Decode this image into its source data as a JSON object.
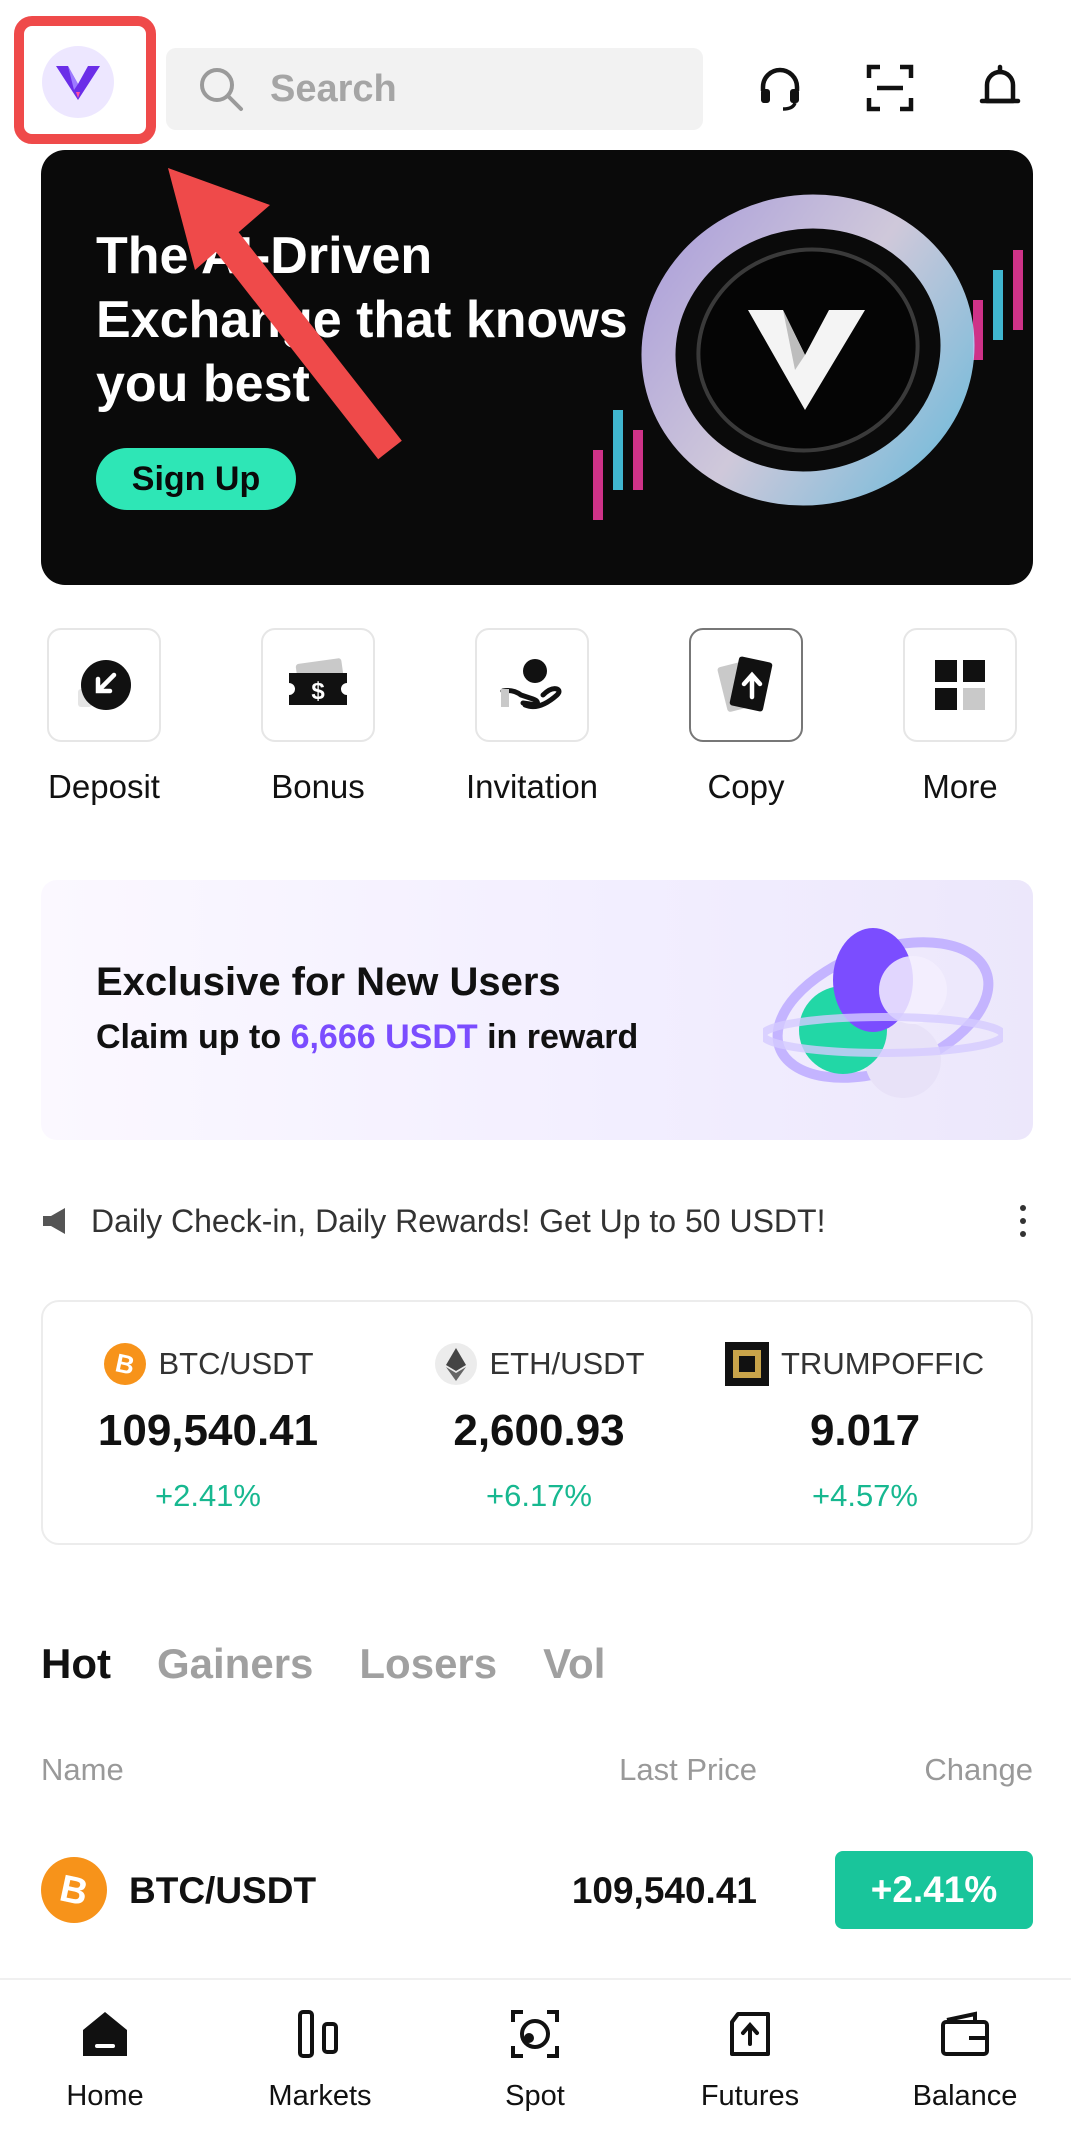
{
  "header": {
    "search_placeholder": "Search",
    "icons": [
      "logo-icon",
      "search-icon",
      "support-headset-icon",
      "scan-icon",
      "bell-icon"
    ]
  },
  "banner": {
    "title": "The AI-Driven Exchange that knows you best",
    "cta_label": "Sign Up"
  },
  "quick_actions": [
    {
      "label": "Deposit",
      "icon": "deposit-icon"
    },
    {
      "label": "Bonus",
      "icon": "bonus-ticket-icon"
    },
    {
      "label": "Invitation",
      "icon": "invitation-icon"
    },
    {
      "label": "Copy",
      "icon": "copy-trade-icon"
    },
    {
      "label": "More",
      "icon": "more-grid-icon"
    }
  ],
  "promo": {
    "title": "Exclusive for New Users",
    "sub_prefix": "Claim up to ",
    "sub_highlight": "6,666 USDT",
    "sub_suffix": " in reward"
  },
  "announcement": {
    "text": "Daily Check-in, Daily Rewards! Get Up to 50 USDT!"
  },
  "tickers": [
    {
      "pair": "BTC/USDT",
      "price": "109,540.41",
      "change": "+2.41%"
    },
    {
      "pair": "ETH/USDT",
      "price": "2,600.93",
      "change": "+6.17%"
    },
    {
      "pair": "TRUMPOFFIC",
      "price": "9.017",
      "change": "+4.57%"
    }
  ],
  "tabs": [
    {
      "label": "Hot",
      "active": true
    },
    {
      "label": "Gainers",
      "active": false
    },
    {
      "label": "Losers",
      "active": false
    },
    {
      "label": "Vol",
      "active": false
    }
  ],
  "table": {
    "headers": {
      "name": "Name",
      "last_price": "Last Price",
      "change": "Change"
    },
    "rows": [
      {
        "pair": "BTC/USDT",
        "price": "109,540.41",
        "change": "+2.41%"
      }
    ]
  },
  "bottom_nav": [
    {
      "label": "Home",
      "active": true
    },
    {
      "label": "Markets",
      "active": false
    },
    {
      "label": "Spot",
      "active": false
    },
    {
      "label": "Futures",
      "active": false
    },
    {
      "label": "Balance",
      "active": false
    }
  ],
  "colors": {
    "accent_green": "#2ee6b6",
    "positive": "#17b890",
    "brand_purple": "#7b4dff",
    "highlight_box": "#ef4a4a"
  }
}
